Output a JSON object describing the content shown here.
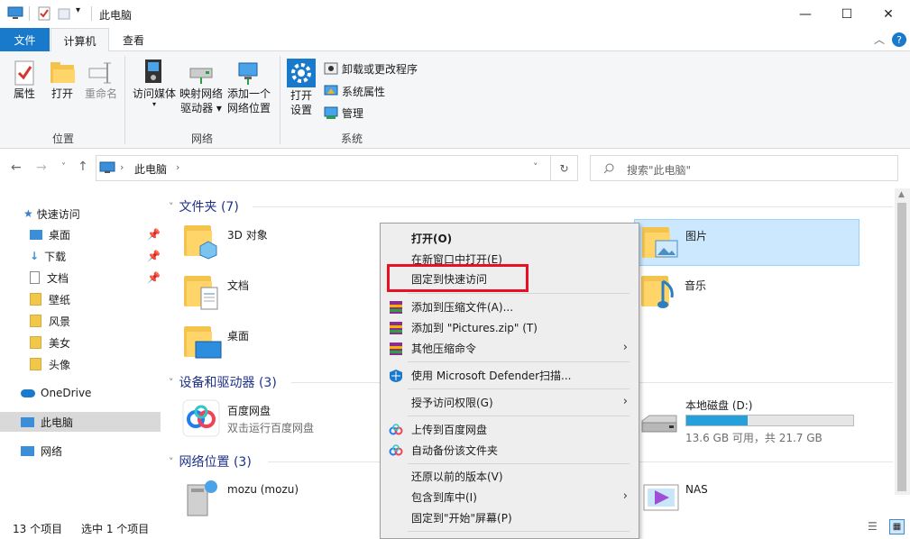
{
  "window": {
    "title": "此电脑"
  },
  "ribbon_tabs": {
    "file": "文件",
    "computer": "计算机",
    "view": "查看"
  },
  "ribbon": {
    "location": {
      "properties": "属性",
      "open": "打开",
      "rename": "重命名",
      "group": "位置"
    },
    "network": {
      "access_media": "访问媒体",
      "map_drive_1": "映射网络",
      "map_drive_2": "驱动器 ▾",
      "add_location_1": "添加一个",
      "add_location_2": "网络位置",
      "group": "网络"
    },
    "system": {
      "open_settings_1": "打开",
      "open_settings_2": "设置",
      "uninstall": "卸载或更改程序",
      "sys_props": "系统属性",
      "manage": "管理",
      "group": "系统"
    }
  },
  "address": {
    "path": "此电脑",
    "search_placeholder": "搜索\"此电脑\""
  },
  "sidebar": {
    "quick_access": "快速访问",
    "items": [
      "桌面",
      "下载",
      "文档",
      "壁纸",
      "风景",
      "美女",
      "头像"
    ],
    "onedrive": "OneDrive",
    "this_pc": "此电脑",
    "network": "网络"
  },
  "content": {
    "folders_header": "文件夹 (7)",
    "folders": [
      "3D 对象",
      "图片",
      "文档",
      "音乐",
      "桌面"
    ],
    "devices_header": "设备和驱动器 (3)",
    "baidu_name": "百度网盘",
    "baidu_sub": "双击运行百度网盘",
    "disk_name": "本地磁盘 (D:)",
    "disk_free": "13.6 GB 可用，共 21.7 GB",
    "disk_used_fraction": 0.37,
    "netloc_header": "网络位置 (3)",
    "mozu": "mozu (mozu)",
    "nas": "NAS"
  },
  "context_menu": {
    "open": "打开(O)",
    "open_new_window": "在新窗口中打开(E)",
    "pin_quick": "固定到快速访问",
    "add_archive": "添加到压缩文件(A)...",
    "add_zip": "添加到 \"Pictures.zip\" (T)",
    "other_compress": "其他压缩命令",
    "defender": "使用 Microsoft Defender扫描...",
    "grant_access": "授予访问权限(G)",
    "upload_baidu": "上传到百度网盘",
    "auto_backup": "自动备份该文件夹",
    "restore": "还原以前的版本(V)",
    "include_library": "包含到库中(I)",
    "pin_start": "固定到\"开始\"屏幕(P)"
  },
  "status": {
    "count": "13 个项目",
    "selected": "选中 1 个项目"
  },
  "colors": {
    "accent": "#1979ca",
    "highlight": "#cce8ff",
    "red_box": "#e81123"
  }
}
